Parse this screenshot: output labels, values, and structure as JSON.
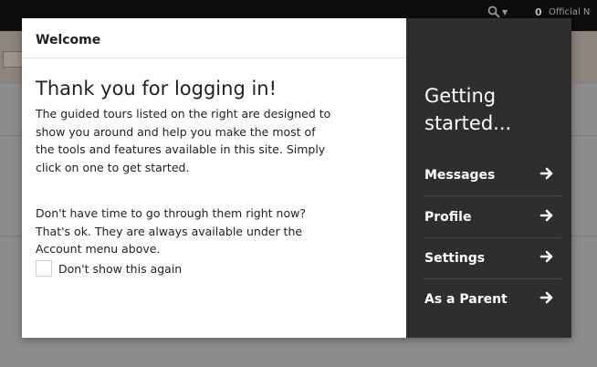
{
  "background": {
    "notification_count": "0",
    "official_text": "Official N"
  },
  "modal": {
    "title": "Welcome",
    "close_label": "×",
    "heading": "Thank you for logging in!",
    "intro_lines": [
      "The guided tours listed on the right are designed to",
      "show you around and help you make the most of",
      "the tools and features available in this site. Simply",
      "click on one to get started."
    ],
    "later_lines": [
      "Don't have time to go through them right now?",
      "That's ok. They are always available under the",
      "Account menu above."
    ],
    "checkbox_label": "Don't show this again",
    "checkbox_checked": false
  },
  "tours": {
    "title_lines": [
      "Getting",
      "started..."
    ],
    "items": [
      {
        "label": "Messages"
      },
      {
        "label": "Profile"
      },
      {
        "label": "Settings"
      },
      {
        "label": "As a Parent"
      }
    ]
  },
  "colors": {
    "panel_bg": "#2e2e2e",
    "overlay_bg": "#8a8a8a"
  }
}
